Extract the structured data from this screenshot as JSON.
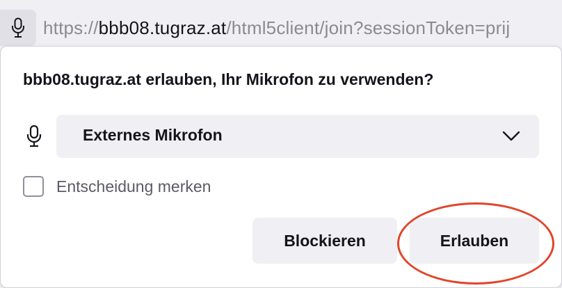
{
  "urlbar": {
    "url_prefix": "https://",
    "url_host": "bbb08.tugraz.at",
    "url_path": "/html5client/join?sessionToken=prij",
    "icon": "microphone-icon"
  },
  "prompt": {
    "question": "bbb08.tugraz.at erlauben, Ihr Mikrofon zu verwenden?",
    "device_icon": "microphone-icon",
    "device_selected": "Externes Mikrofon",
    "remember_label": "Entscheidung merken",
    "remember_checked": false,
    "block_label": "Blockieren",
    "allow_label": "Erlauben"
  },
  "colors": {
    "highlight_ring": "#e2452b",
    "button_bg": "#f0f0f4",
    "text": "#15141a"
  }
}
